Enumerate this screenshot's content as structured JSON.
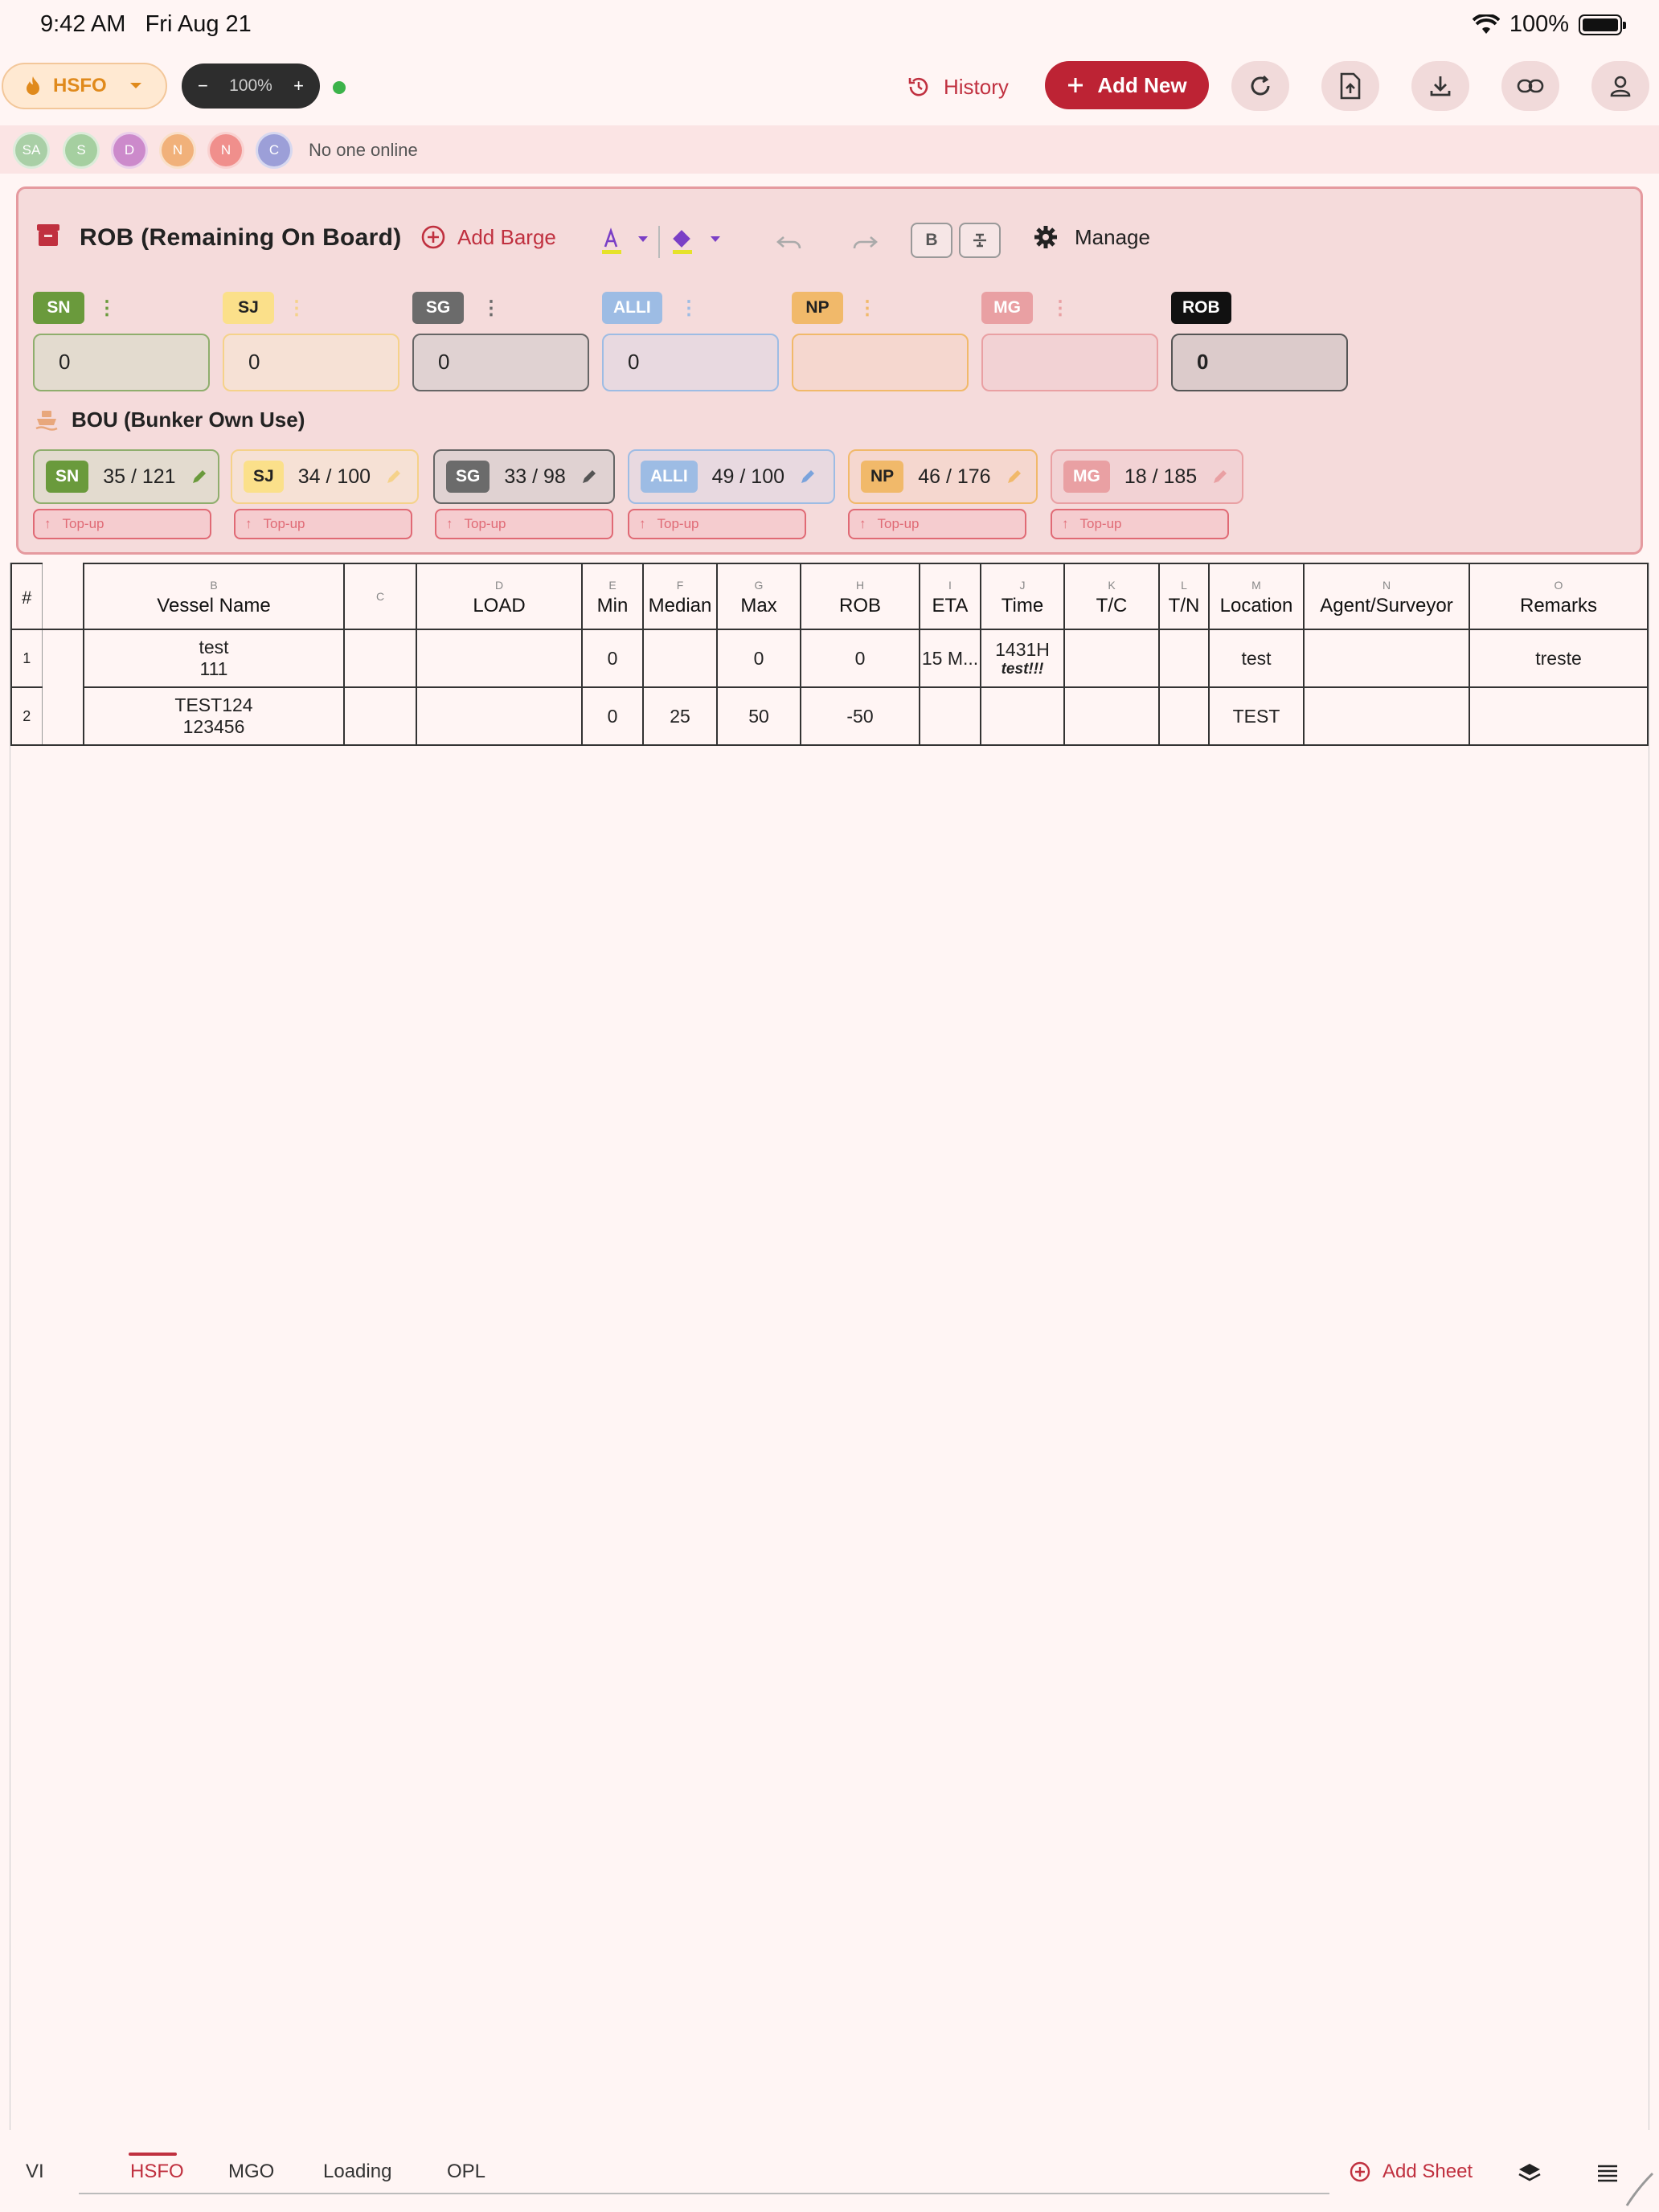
{
  "status_bar": {
    "time": "9:42 AM",
    "date": "Fri Aug 21",
    "battery": "100%"
  },
  "toolbar": {
    "fuel_type": "HSFO",
    "zoom": "100%",
    "zoom_minus": "−",
    "zoom_plus": "+",
    "history_label": "History",
    "add_new_label": "Add New"
  },
  "users": {
    "avatars": [
      {
        "initials": "SA",
        "color": "#a9cfa6"
      },
      {
        "initials": "S",
        "color": "#a5cfa0"
      },
      {
        "initials": "D",
        "color": "#cc8acb"
      },
      {
        "initials": "N",
        "color": "#f1b17a"
      },
      {
        "initials": "N",
        "color": "#f08f8c"
      },
      {
        "initials": "C",
        "color": "#9c9fd8"
      }
    ],
    "status": "No one online"
  },
  "rob": {
    "title": "ROB (Remaining On Board)",
    "add_barge_label": "Add Barge",
    "bold_label": "B",
    "manage_label": "Manage",
    "barges": [
      {
        "tag": "SN",
        "value": "0",
        "tag_bg": "#6a9a3c",
        "tag_fg": "#ffffff",
        "box_bg": "#e3dbcf",
        "box_border": "#8fae6d"
      },
      {
        "tag": "SJ",
        "value": "0",
        "tag_bg": "#fbe08a",
        "tag_fg": "#222222",
        "box_bg": "#f6e1d5",
        "box_border": "#f5d28a"
      },
      {
        "tag": "SG",
        "value": "0",
        "tag_bg": "#6b6b6b",
        "tag_fg": "#ffffff",
        "box_bg": "#e0d2d2",
        "box_border": "#666666"
      },
      {
        "tag": "ALLI",
        "value": "0",
        "tag_bg": "#9dbce4",
        "tag_fg": "#ffffff",
        "box_bg": "#e8d9e0",
        "box_border": "#9dbce4"
      },
      {
        "tag": "NP",
        "value": "",
        "tag_bg": "#f1b96a",
        "tag_fg": "#222222",
        "box_bg": "#f5d7cf",
        "box_border": "#f1b96a"
      },
      {
        "tag": "MG",
        "value": "",
        "tag_bg": "#e9a0a3",
        "tag_fg": "#ffffff",
        "box_bg": "#f2d2d4",
        "box_border": "#e9a0a3"
      },
      {
        "tag": "ROB",
        "value": "0",
        "tag_bg": "#111111",
        "tag_fg": "#ffffff",
        "box_bg": "#dccbcb",
        "box_border": "#555555"
      }
    ]
  },
  "bou": {
    "title": "BOU (Bunker Own Use)",
    "topup_label": "Top-up",
    "chips": [
      {
        "tag": "SN",
        "value": "35 / 121",
        "tag_bg": "#6a9a3c",
        "tag_fg": "#ffffff",
        "bg": "#e3dbcf",
        "border": "#8fae6d",
        "pencil": "#6a9a3c"
      },
      {
        "tag": "SJ",
        "value": "34 / 100",
        "tag_bg": "#fbe08a",
        "tag_fg": "#222222",
        "bg": "#f6e1d5",
        "border": "#f5d28a",
        "pencil": "#f5d28a"
      },
      {
        "tag": "SG",
        "value": "33 / 98",
        "tag_bg": "#6b6b6b",
        "tag_fg": "#ffffff",
        "bg": "#e0d2d2",
        "border": "#666666",
        "pencil": "#555555"
      },
      {
        "tag": "ALLI",
        "value": "49 / 100",
        "tag_bg": "#9dbce4",
        "tag_fg": "#ffffff",
        "bg": "#e8d9e0",
        "border": "#9dbce4",
        "pencil": "#7aa3dc"
      },
      {
        "tag": "NP",
        "value": "46 / 176",
        "tag_bg": "#f1b96a",
        "tag_fg": "#222222",
        "bg": "#f5d7cf",
        "border": "#f1b96a",
        "pencil": "#f1b96a"
      },
      {
        "tag": "MG",
        "value": "18 / 185",
        "tag_bg": "#e9a0a3",
        "tag_fg": "#ffffff",
        "bg": "#f2d2d4",
        "border": "#e9a0a3",
        "pencil": "#e9a0a3"
      }
    ]
  },
  "table": {
    "row_header": "#",
    "columns": [
      {
        "letter": "B",
        "name": "Vessel Name"
      },
      {
        "letter": "C",
        "name": ""
      },
      {
        "letter": "D",
        "name": "LOAD"
      },
      {
        "letter": "E",
        "name": "Min"
      },
      {
        "letter": "F",
        "name": "Median"
      },
      {
        "letter": "G",
        "name": "Max"
      },
      {
        "letter": "H",
        "name": "ROB"
      },
      {
        "letter": "I",
        "name": "ETA"
      },
      {
        "letter": "J",
        "name": "Time"
      },
      {
        "letter": "K",
        "name": "T/C"
      },
      {
        "letter": "L",
        "name": "T/N"
      },
      {
        "letter": "M",
        "name": "Location"
      },
      {
        "letter": "N",
        "name": "Agent/Surveyor"
      },
      {
        "letter": "O",
        "name": "Remarks"
      }
    ],
    "rows": [
      {
        "num": "1",
        "vessel_line1": "test",
        "vessel_line2": "111",
        "c": "",
        "load": "",
        "min": "0",
        "median": "",
        "max": "0",
        "rob": "0",
        "eta": "15 M...",
        "time_line1": "1431H",
        "time_line2": "test!!!",
        "tc": "",
        "tn": "",
        "location": "test",
        "agent": "",
        "remarks": "treste"
      },
      {
        "num": "2",
        "vessel_line1": "TEST124",
        "vessel_line2": "123456",
        "c": "",
        "load": "",
        "min": "0",
        "median": "25",
        "max": "50",
        "rob": "-50",
        "eta": "",
        "time_line1": "",
        "time_line2": "",
        "tc": "",
        "tn": "",
        "location": "TEST",
        "agent": "",
        "remarks": ""
      }
    ]
  },
  "bottom": {
    "left_fragment": "VI",
    "tabs": [
      "HSFO",
      "MGO",
      "Loading",
      "OPL"
    ],
    "active_tab": "HSFO",
    "add_sheet_label": "Add Sheet"
  }
}
